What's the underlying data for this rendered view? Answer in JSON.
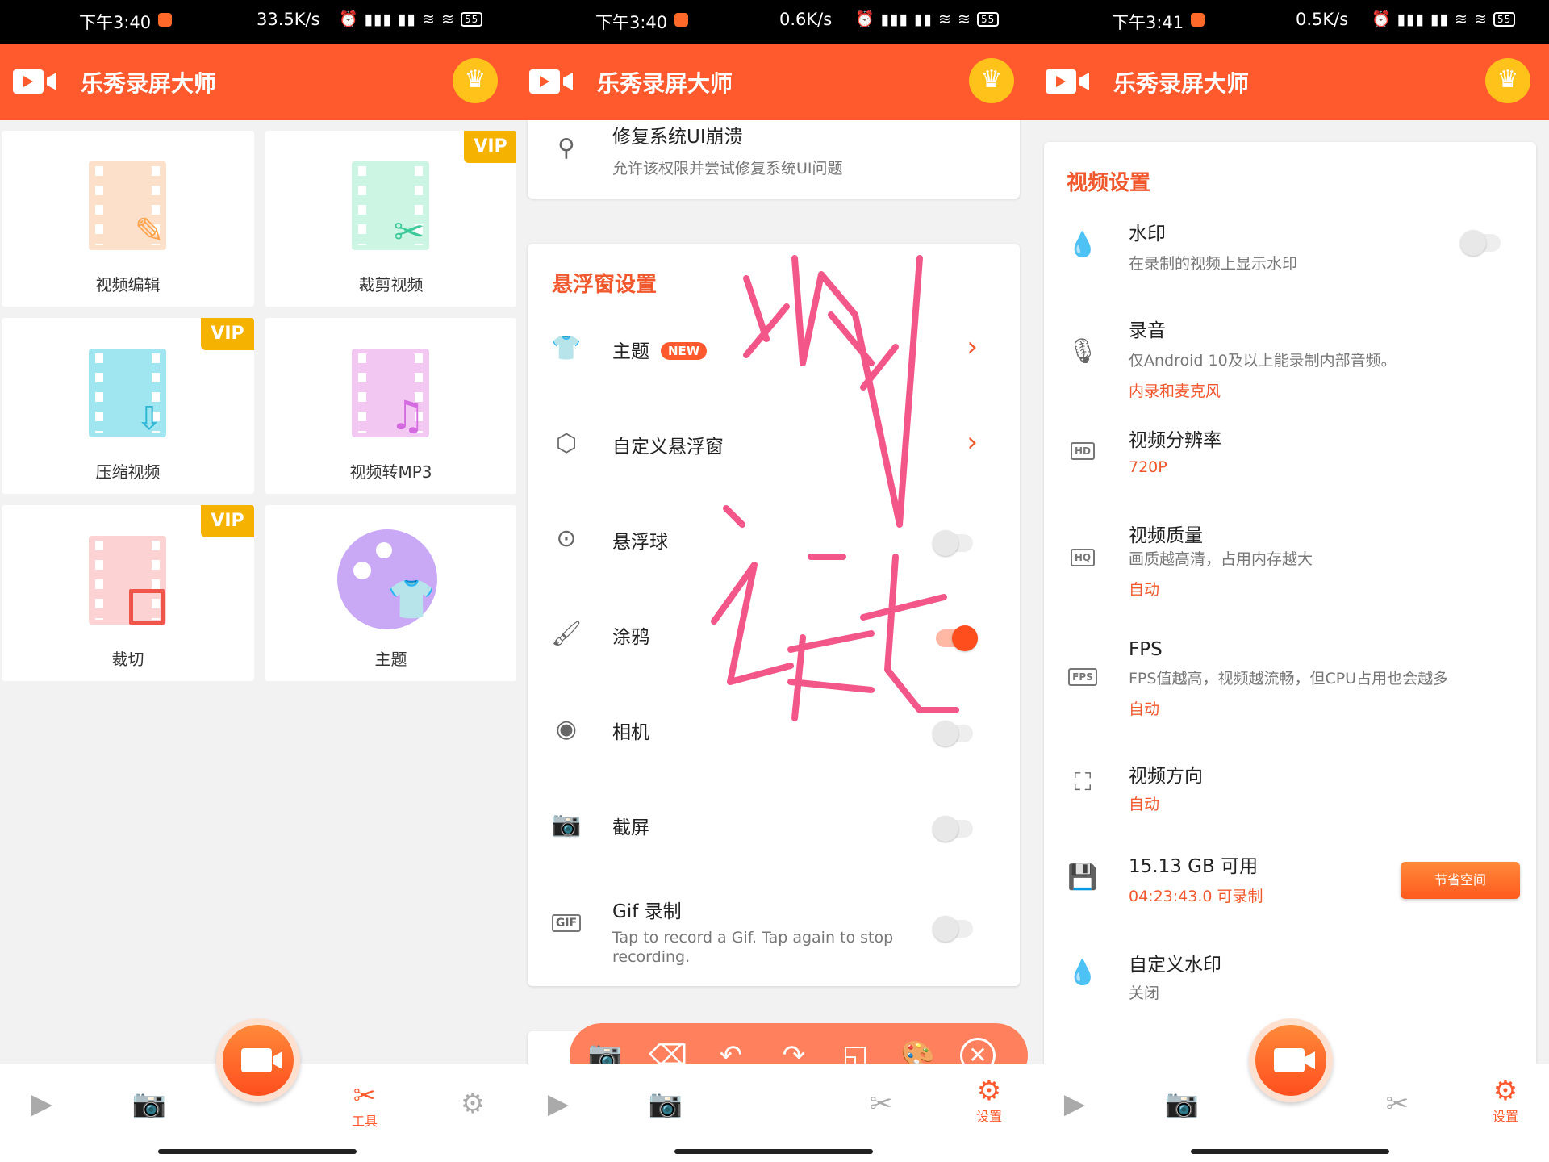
{
  "status_bars": [
    {
      "time": "下午3:40",
      "speed": "33.5K/s",
      "icons": "⏰ ▮▮▮ ▮▮ ≋ ≋",
      "battery": "55"
    },
    {
      "time": "下午3:40",
      "speed": "0.6K/s",
      "icons": "⏰ ▮▮▮ ▮▮ ≋ ≋",
      "battery": "55"
    },
    {
      "time": "下午3:41",
      "speed": "0.5K/s",
      "icons": "⏰ ▮▮▮ ▮▮ ≋ ≋",
      "battery": "55"
    }
  ],
  "app": {
    "title": "乐秀录屏大师",
    "accent": "#ff5a2e",
    "crown_icon": "crown-icon"
  },
  "tools": {
    "vip_label": "VIP",
    "items": [
      {
        "label": "视频编辑",
        "vip": false
      },
      {
        "label": "裁剪视频",
        "vip": true
      },
      {
        "label": "压缩视频",
        "vip": true
      },
      {
        "label": "视频转MP3",
        "vip": false
      },
      {
        "label": "裁切",
        "vip": true
      },
      {
        "label": "主题",
        "vip": false
      }
    ]
  },
  "nav": {
    "tools_label": "工具",
    "settings_label": "设置"
  },
  "floating": {
    "repair_title": "修复系统UI崩溃",
    "repair_desc": "允许该权限并尝试修复系统UI问题",
    "section_title": "悬浮窗设置",
    "new_badge": "NEW",
    "rows": [
      {
        "title": "主题",
        "type": "chevron"
      },
      {
        "title": "自定义悬浮窗",
        "type": "chevron"
      },
      {
        "title": "悬浮球",
        "type": "toggle",
        "on": false
      },
      {
        "title": "涂鸦",
        "type": "toggle",
        "on": true
      },
      {
        "title": "相机",
        "type": "toggle",
        "on": false
      },
      {
        "title": "截屏",
        "type": "toggle",
        "on": false
      }
    ],
    "gif_title": "Gif 录制",
    "gif_desc": "Tap to record a Gif. Tap again to stop recording.",
    "gif_on": false
  },
  "video": {
    "section_title": "视频设置",
    "watermark": {
      "title": "水印",
      "desc": "在录制的视频上显示水印",
      "on": false
    },
    "audio": {
      "title": "录音",
      "desc": "仅Android 10及以上能录制内部音频。",
      "value": "内录和麦克风"
    },
    "resolution": {
      "title": "视频分辨率",
      "value": "720P",
      "icon_text": "HD"
    },
    "quality": {
      "title": "视频质量",
      "desc": "画质越高清，占用内存越大",
      "value": "自动",
      "icon_text": "HQ"
    },
    "fps": {
      "title": "FPS",
      "desc": "FPS值越高，视频越流畅，但CPU占用也会越多",
      "value": "自动",
      "icon_text": "FPS"
    },
    "orientation": {
      "title": "视频方向",
      "value": "自动"
    },
    "storage": {
      "title": "15.13 GB 可用",
      "value": "04:23:43.0 可录制",
      "button": "节省空间"
    },
    "custom_watermark": {
      "title": "自定义水印",
      "value": "关闭"
    }
  }
}
